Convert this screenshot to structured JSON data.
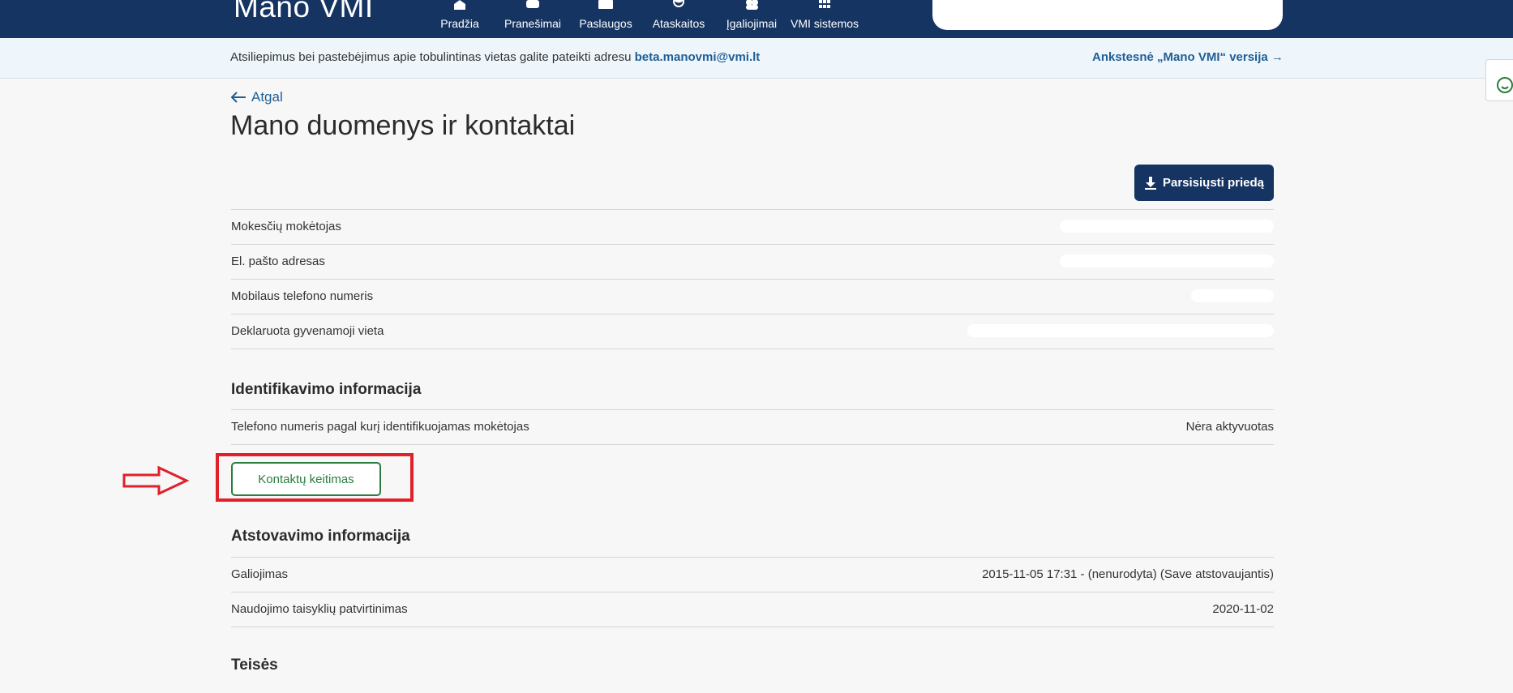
{
  "header": {
    "logo": "Mano VMI",
    "nav": [
      {
        "label": "Pradžia",
        "icon": "home-icon"
      },
      {
        "label": "Pranešimai",
        "icon": "messages-icon"
      },
      {
        "label": "Paslaugos",
        "icon": "mail-icon"
      },
      {
        "label": "Ataskaitos",
        "icon": "pie-chart-icon"
      },
      {
        "label": "Įgaliojimai",
        "icon": "users-icon"
      },
      {
        "label": "VMI sistemos",
        "icon": "grid-icon"
      }
    ]
  },
  "banner": {
    "text": "Atsiliepimus bei pastebėjimus apie tobulintinas vietas galite pateikti adresu",
    "email": "beta.manovmi@vmi.lt",
    "old_version_link": "Ankstesnė „Mano VMI“ versija →"
  },
  "page": {
    "back_label": "Atgal",
    "title": "Mano duomenys ir kontaktai",
    "download_label": "Parsisiųsti priedą"
  },
  "personal_rows": [
    {
      "label": "Mokesčių mokėtojas"
    },
    {
      "label": "El. pašto adresas"
    },
    {
      "label": "Mobilaus telefono numeris"
    },
    {
      "label": "Deklaruota gyvenamoji vieta"
    }
  ],
  "identification": {
    "title": "Identifikavimo informacija",
    "rows": [
      {
        "label": "Telefono numeris pagal kurį identifikuojamas mokėtojas",
        "value": "Nėra aktyvuotas"
      }
    ]
  },
  "change_contacts_label": "Kontaktų keitimas",
  "representation": {
    "title": "Atstovavimo informacija",
    "rows": [
      {
        "label": "Galiojimas",
        "value": "2015-11-05 17:31 - (nenurodyta) (Save atstovaujantis)"
      },
      {
        "label": "Naudojimo taisyklių patvirtinimas",
        "value": "2020-11-02"
      }
    ]
  },
  "rights": {
    "title": "Teisės"
  },
  "colors": {
    "nav_bg": "#163462",
    "link": "#1f5e95",
    "accent_green": "#2a7d3f",
    "highlight_red": "#e0202a"
  }
}
